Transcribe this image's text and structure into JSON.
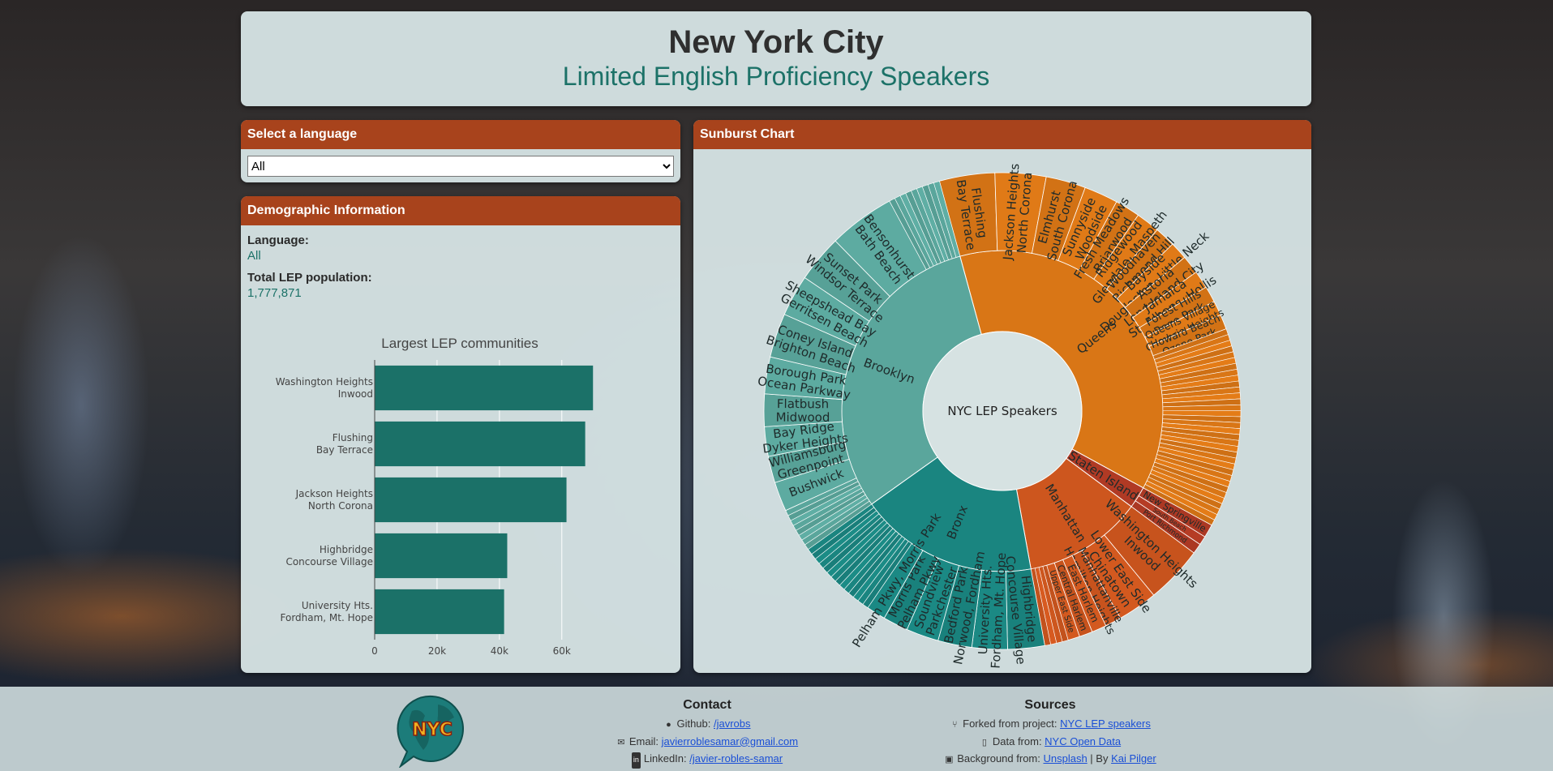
{
  "header": {
    "title": "New York City",
    "subtitle": "Limited English Proficiency Speakers"
  },
  "language_panel": {
    "title": "Select a language",
    "selected": "All",
    "options": [
      "All"
    ]
  },
  "demographics": {
    "title": "Demographic Information",
    "language_label": "Language:",
    "language_value": "All",
    "population_label": "Total LEP population:",
    "population_value": "1,777,871"
  },
  "bar_chart": {
    "chart_data": {
      "type": "bar",
      "orientation": "horizontal",
      "title": "Largest LEP communities",
      "categories": [
        [
          "Washington Heights",
          "Inwood"
        ],
        [
          "Flushing",
          "Bay Terrace"
        ],
        [
          "Jackson Heights",
          "North Corona"
        ],
        [
          "Highbridge",
          "Concourse Village"
        ],
        [
          "University Hts.",
          "Fordham, Mt. Hope"
        ]
      ],
      "values": [
        70000,
        67500,
        61500,
        42500,
        41500
      ],
      "xlim": [
        0,
        78000
      ],
      "xticks": [
        0,
        20000,
        40000,
        60000
      ],
      "xtick_labels": [
        "0",
        "20k",
        "40k",
        "60k"
      ],
      "grid": true,
      "color": "#1b7168"
    }
  },
  "sunburst": {
    "title": "Sunburst Chart",
    "chart_data": {
      "type": "sunburst",
      "root": "NYC LEP Speakers",
      "boroughs": [
        {
          "name": "Queens",
          "value": 37.2,
          "color": "#d97616",
          "children": [
            {
              "name": "Flushing\nBay Terrace",
              "value": 3.75
            },
            {
              "name": "Jackson Heights\nNorth Corona",
              "value": 3.45
            },
            {
              "name": "Elmhurst\nSouth Corona",
              "value": 2.7
            },
            {
              "name": "Sunnyside\nWoodside",
              "value": 2.3
            },
            {
              "name": "Fresh Meadows\nBriarwood",
              "value": 1.7
            },
            {
              "name": "Ridgewood\nGlendale, Maspeth",
              "value": 1.6
            },
            {
              "name": "Woodhaven\nRichmond Hill",
              "value": 1.4
            },
            {
              "name": "Bayside\nDouglaston, Little Neck",
              "value": 1.2
            },
            {
              "name": "Astoria\nLong Island City",
              "value": 1.25
            },
            {
              "name": "Jamaica\nSt. Albans, Hollis",
              "value": 1.2
            },
            {
              "name": "Forest Hills\nRego Park",
              "value": 1.1
            },
            {
              "name": "Queens Village\nCambria Heights",
              "value": 1.0
            },
            {
              "name": "Howard Beach\nOzone Park",
              "value": 1.0
            },
            {
              "name": "",
              "value": 13.55
            }
          ]
        },
        {
          "name": "Staten Island",
          "value": 2.2,
          "color": "#b03a24",
          "children": [
            {
              "name": "New Springville",
              "value": 0.9
            },
            {
              "name": "South Beach",
              "value": 0.6
            },
            {
              "name": "Port Richmond",
              "value": 0.7
            }
          ]
        },
        {
          "name": "Manhattan",
          "value": 12.0,
          "color": "#cd561e",
          "children": [
            {
              "name": "Washington Heights\nInwood",
              "value": 3.9
            },
            {
              "name": "Lower East Side\nChinatown",
              "value": 2.7
            },
            {
              "name": "Manhattanville\nHamilton Heights",
              "value": 1.1
            },
            {
              "name": "East Harlem",
              "value": 1.0
            },
            {
              "name": "Central Harlem",
              "value": 0.9
            },
            {
              "name": "Upper East Side",
              "value": 0.8
            },
            {
              "name": "",
              "value": 1.6
            }
          ]
        },
        {
          "name": "Bronx",
          "value": 18.0,
          "color": "#1a8580",
          "children": [
            {
              "name": "Highbridge\nConcourse Village",
              "value": 2.5
            },
            {
              "name": "University Hts.\nFordham, Mt. Hope",
              "value": 2.4
            },
            {
              "name": "Bedford Park\nNorwood, Fordham",
              "value": 2.3
            },
            {
              "name": "Soundview\nParkchester",
              "value": 2.2
            },
            {
              "name": "Morris Park\nPelham Pkwy",
              "value": 1.7
            },
            {
              "name": "Pelham Pkwy, Morris Park",
              "value": 1.3
            },
            {
              "name": "",
              "value": 5.6
            }
          ]
        },
        {
          "name": "Brooklyn",
          "value": 30.6,
          "color": "#5aa69c",
          "children": [
            {
              "name": "",
              "value": 3.0
            },
            {
              "name": "Bushwick",
              "value": 2.0
            },
            {
              "name": "Williamsburg\nGreenpoint",
              "value": 1.8
            },
            {
              "name": "Bay Ridge\nDyker Heights",
              "value": 2.0
            },
            {
              "name": "Flatbush\nMidwood",
              "value": 2.2
            },
            {
              "name": "Borough Park\nOcean Parkway",
              "value": 2.5
            },
            {
              "name": "Coney Island\nBrighton Beach",
              "value": 3.0
            },
            {
              "name": "Sheepshead Bay\nGerritsen Beach",
              "value": 2.8
            },
            {
              "name": "Sunset Park\nWindsor Terrace",
              "value": 3.2
            },
            {
              "name": "Bensonhurst\nBath Beach",
              "value": 4.5
            },
            {
              "name": "",
              "value": 3.6
            }
          ]
        }
      ]
    }
  },
  "footer": {
    "logo_text": "NYC",
    "contact": {
      "title": "Contact",
      "github_label": "Github: ",
      "github_link": "/javrobs",
      "email_label": "Email: ",
      "email_link": "javierroblesamar@gmail.com",
      "linkedin_label": "LinkedIn: ",
      "linkedin_link": "/javier-robles-samar"
    },
    "sources": {
      "title": "Sources",
      "fork_label": "Forked from project: ",
      "fork_link": "NYC LEP speakers",
      "data_label": "Data from: ",
      "data_link": "NYC Open Data",
      "bg_label": "Background from: ",
      "bg_link_1": "Unsplash",
      "bg_separator": " | By ",
      "bg_link_2": "Kai Pilger"
    }
  }
}
